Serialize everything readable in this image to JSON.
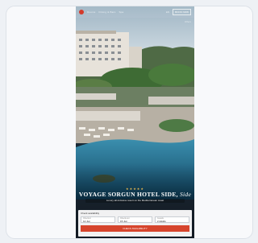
{
  "header": {
    "nav": [
      "Rooms",
      "Dining & Bars",
      "Spa"
    ],
    "language": "EN",
    "book_label": "BOOK NOW",
    "sub_link": "Offers"
  },
  "hero": {
    "stars": "★★★★★",
    "title_main": "VOYAGE SORGUN HOTEL SIDE,",
    "title_script": "Side",
    "subtitle": "Luxury all-inclusive resort on the Mediterranean coast"
  },
  "booking": {
    "title": "Check availability",
    "fields": [
      {
        "label": "Check-in",
        "value": "12 Jun"
      },
      {
        "label": "Check-out",
        "value": "15 Jun"
      },
      {
        "label": "Guests",
        "value": "2 Adults"
      }
    ],
    "cta_label": "CHECK AVAILABILITY"
  },
  "colors": {
    "accent": "#d6452d",
    "sky": "#c5d3dc",
    "pool": "#2a7a9a"
  }
}
